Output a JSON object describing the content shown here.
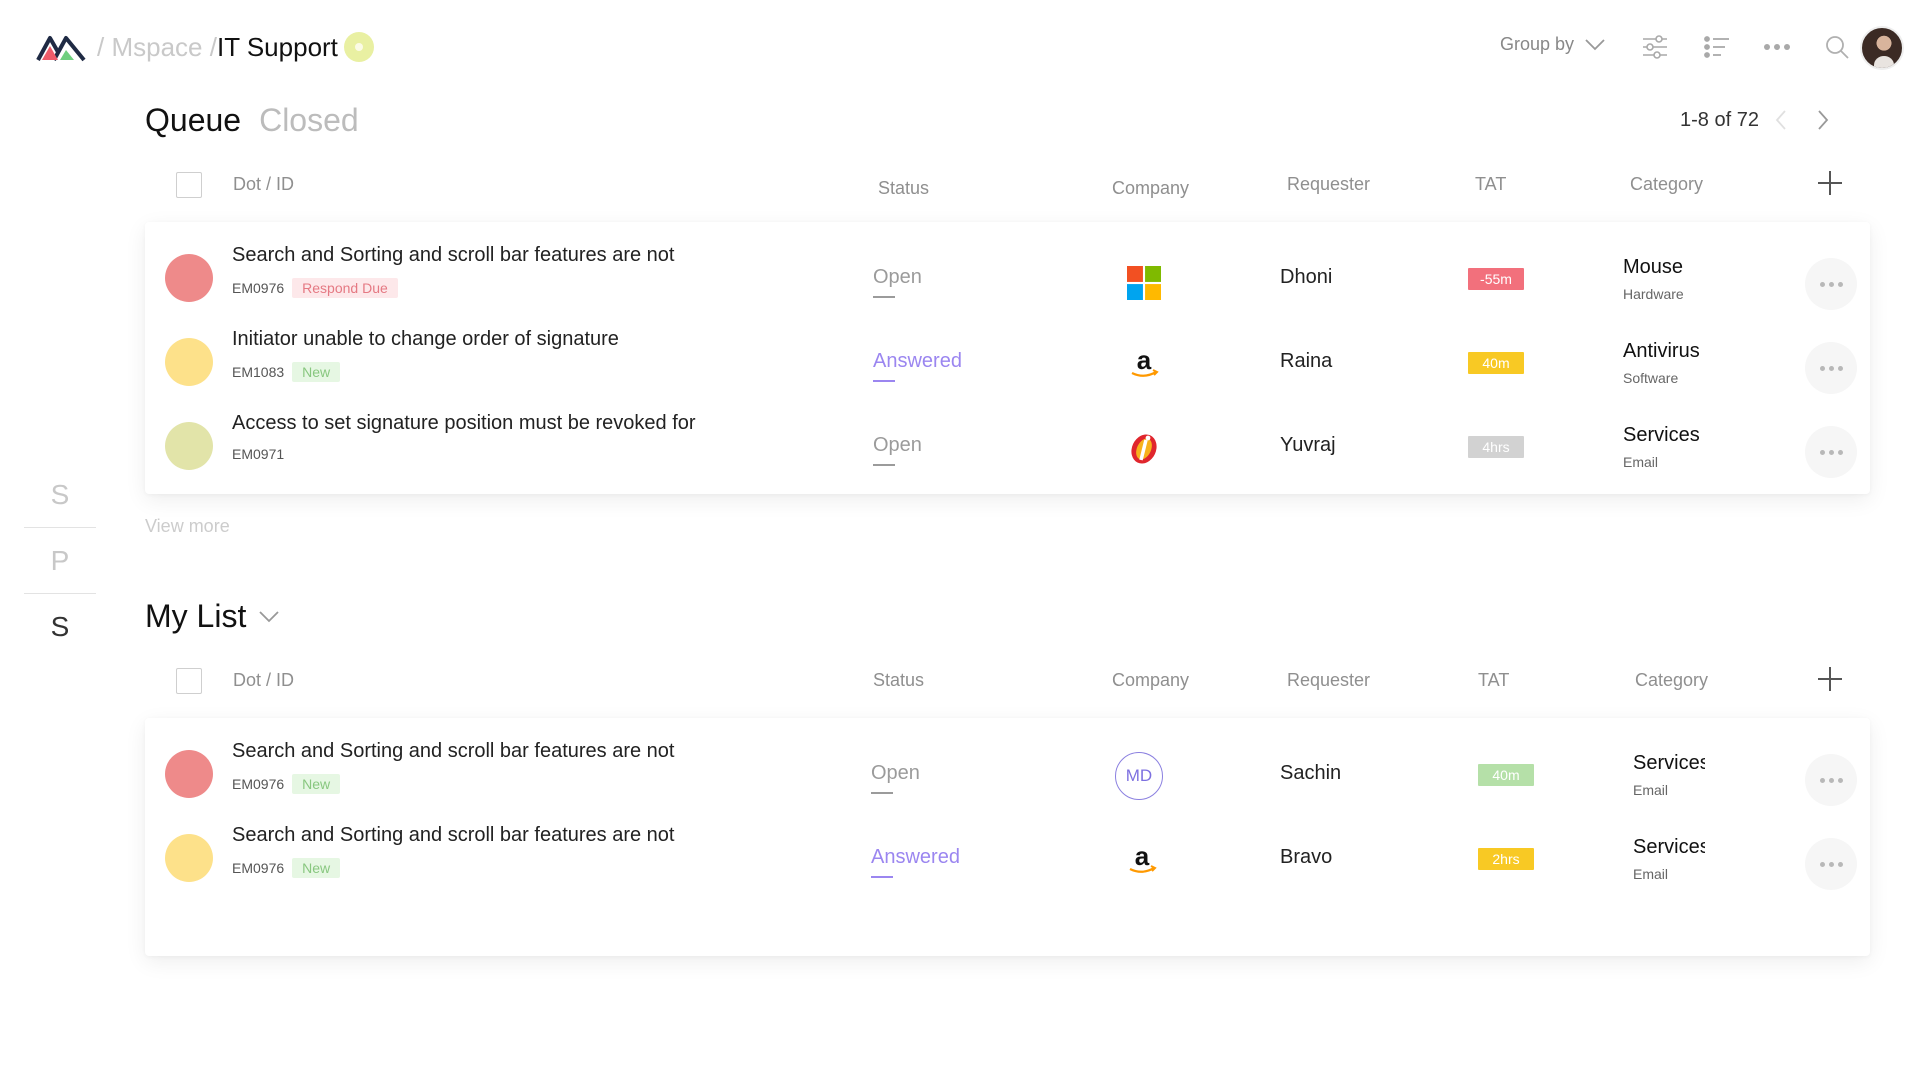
{
  "header": {
    "breadcrumb_sep1": "/",
    "breadcrumb_root": "Mspace",
    "breadcrumb_sep2": "/",
    "breadcrumb_current": "IT Support",
    "group_by_label": "Group by",
    "icons": [
      "filter-sliders-icon",
      "list-view-icon",
      "more-horizontal-icon",
      "search-icon"
    ]
  },
  "rail": {
    "items": [
      "S",
      "P",
      "S"
    ]
  },
  "queue": {
    "tabs": [
      {
        "label": "Queue",
        "active": true
      },
      {
        "label": "Closed",
        "active": false
      }
    ],
    "pager_text": "1-8 of 72",
    "columns": [
      "Dot / ID",
      "Status",
      "Company",
      "Requester",
      "TAT",
      "Category"
    ],
    "rows": [
      {
        "dot_color": "#ee8a8a",
        "title": "Search and Sorting and scroll bar features are not",
        "id": "EM0976",
        "badge": "Respond Due",
        "badge_type": "due",
        "status": "Open",
        "company": "microsoft-logo",
        "requester": "Dhoni",
        "tat": "-55m",
        "tat_color": "#f2707c",
        "category": "Mouse",
        "subcategory": "Hardware"
      },
      {
        "dot_color": "#fde18a",
        "title": "Initiator unable to change order of signature",
        "id": "EM1083",
        "badge": "New",
        "badge_type": "new",
        "status": "Answered",
        "company": "amazon-logo",
        "requester": "Raina",
        "tat": "40m",
        "tat_color": "#f8c924",
        "category": "Antivirus",
        "subcategory": "Software"
      },
      {
        "dot_color": "#e2e4a9",
        "title": "Access to set signature position must be revoked for",
        "id": "EM0971",
        "badge": "",
        "badge_type": "",
        "status": "Open",
        "company": "icici-logo",
        "requester": "Yuvraj",
        "tat": "4hrs",
        "tat_color": "#d2d2d2",
        "category": "Services",
        "subcategory": "Email"
      }
    ],
    "view_more": "View more"
  },
  "mylist": {
    "title": "My List",
    "columns": [
      "Dot / ID",
      "Status",
      "Company",
      "Requester",
      "TAT",
      "Category"
    ],
    "rows": [
      {
        "dot_color": "#ee8a8a",
        "title": "Search and Sorting and scroll bar features are not",
        "id": "EM0976",
        "badge": "New",
        "badge_type": "new",
        "status": "Open",
        "company": "MD",
        "requester": "Sachin",
        "tat": "40m",
        "tat_color": "#b5e0a8",
        "category": "Services",
        "subcategory": "Email"
      },
      {
        "dot_color": "#fde18a",
        "title": "Search and Sorting and scroll bar features are not",
        "id": "EM0976",
        "badge": "New",
        "badge_type": "new",
        "status": "Answered",
        "company": "amazon-logo",
        "requester": "Bravo",
        "tat": "2hrs",
        "tat_color": "#f8c924",
        "category": "Services",
        "subcategory": "Email"
      }
    ]
  }
}
